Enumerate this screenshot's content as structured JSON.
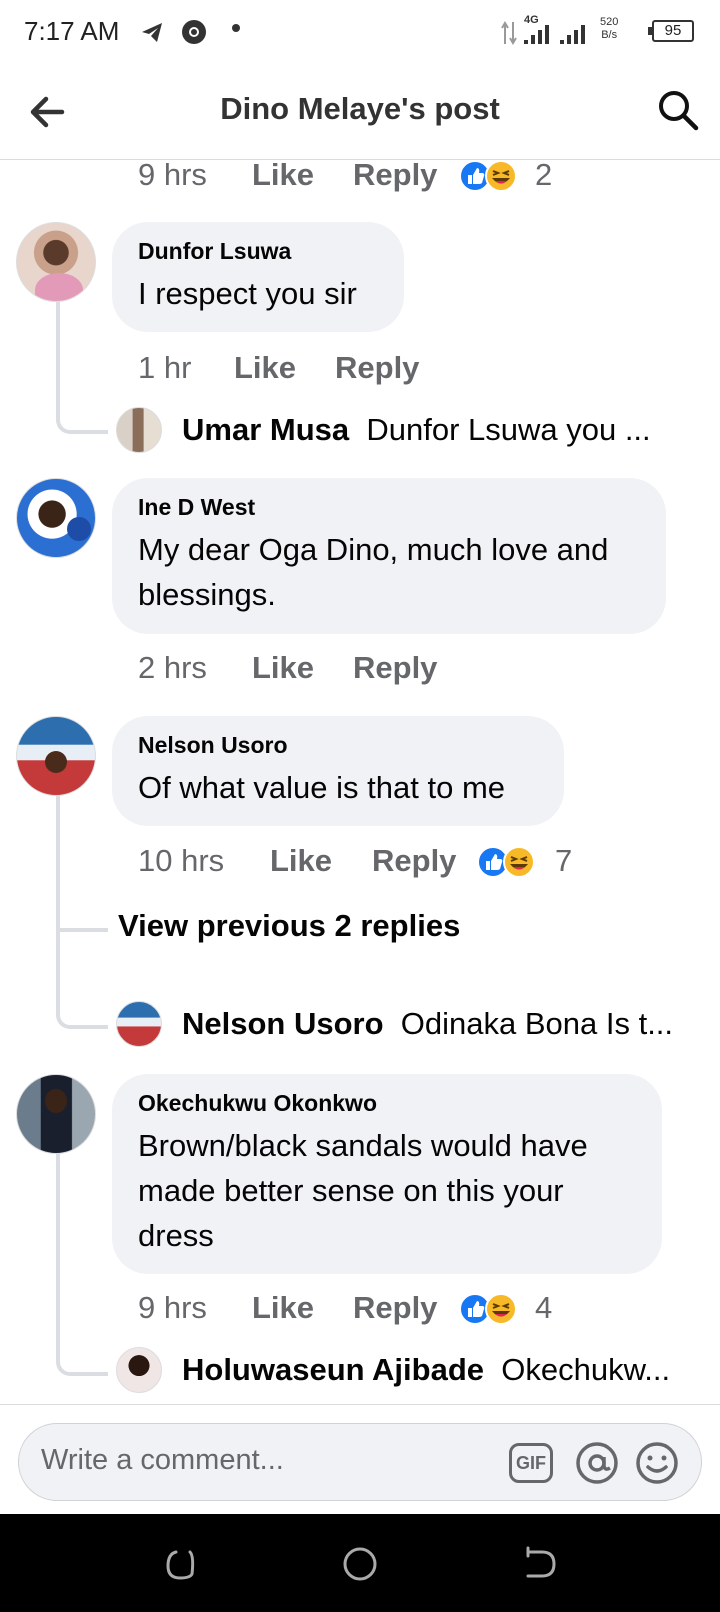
{
  "status_bar": {
    "time": "7:17 AM",
    "network_label": "4G",
    "net_speed_value": "520",
    "net_speed_unit": "B/s",
    "battery": "95"
  },
  "header": {
    "title": "Dino Melaye's post",
    "back_icon": "arrow-left-icon",
    "search_icon": "search-icon"
  },
  "comments": [
    {
      "meta": {
        "time": "9 hrs",
        "like": "Like",
        "reply": "Reply",
        "reaction_count": "2"
      }
    },
    {
      "author": "Dunfor Lsuwa",
      "text": "I respect you sir",
      "meta": {
        "time": "1 hr",
        "like": "Like",
        "reply": "Reply"
      },
      "reply_preview": {
        "author": "Umar Musa",
        "text": "Dunfor Lsuwa  you ..."
      }
    },
    {
      "author": "Ine D West",
      "text": "My dear Oga Dino, much love and blessings.",
      "meta": {
        "time": "2 hrs",
        "like": "Like",
        "reply": "Reply"
      }
    },
    {
      "author": "Nelson Usoro",
      "text": "Of what value is that to me",
      "meta": {
        "time": "10 hrs",
        "like": "Like",
        "reply": "Reply",
        "reaction_count": "7"
      },
      "view_previous": "View previous 2 replies",
      "reply_preview": {
        "author": "Nelson Usoro",
        "text": "Odinaka Bona Is t..."
      }
    },
    {
      "author": "Okechukwu Okonkwo",
      "text": "Brown/black sandals would have made better sense on this your dress",
      "meta": {
        "time": "9 hrs",
        "like": "Like",
        "reply": "Reply",
        "reaction_count": "4"
      },
      "reply_preview": {
        "author": "Holuwaseun Ajibade",
        "text": "Okechukw..."
      }
    }
  ],
  "composer": {
    "placeholder": "Write a comment...",
    "gif_label": "GIF",
    "mention_icon": "at-sign-icon",
    "emoji_icon": "smiley-icon"
  },
  "colors": {
    "bubble_bg": "#f0f2f5",
    "meta_text": "#65676b",
    "like_blue": "#1877f2",
    "haha_yellow": "#f7b928"
  }
}
